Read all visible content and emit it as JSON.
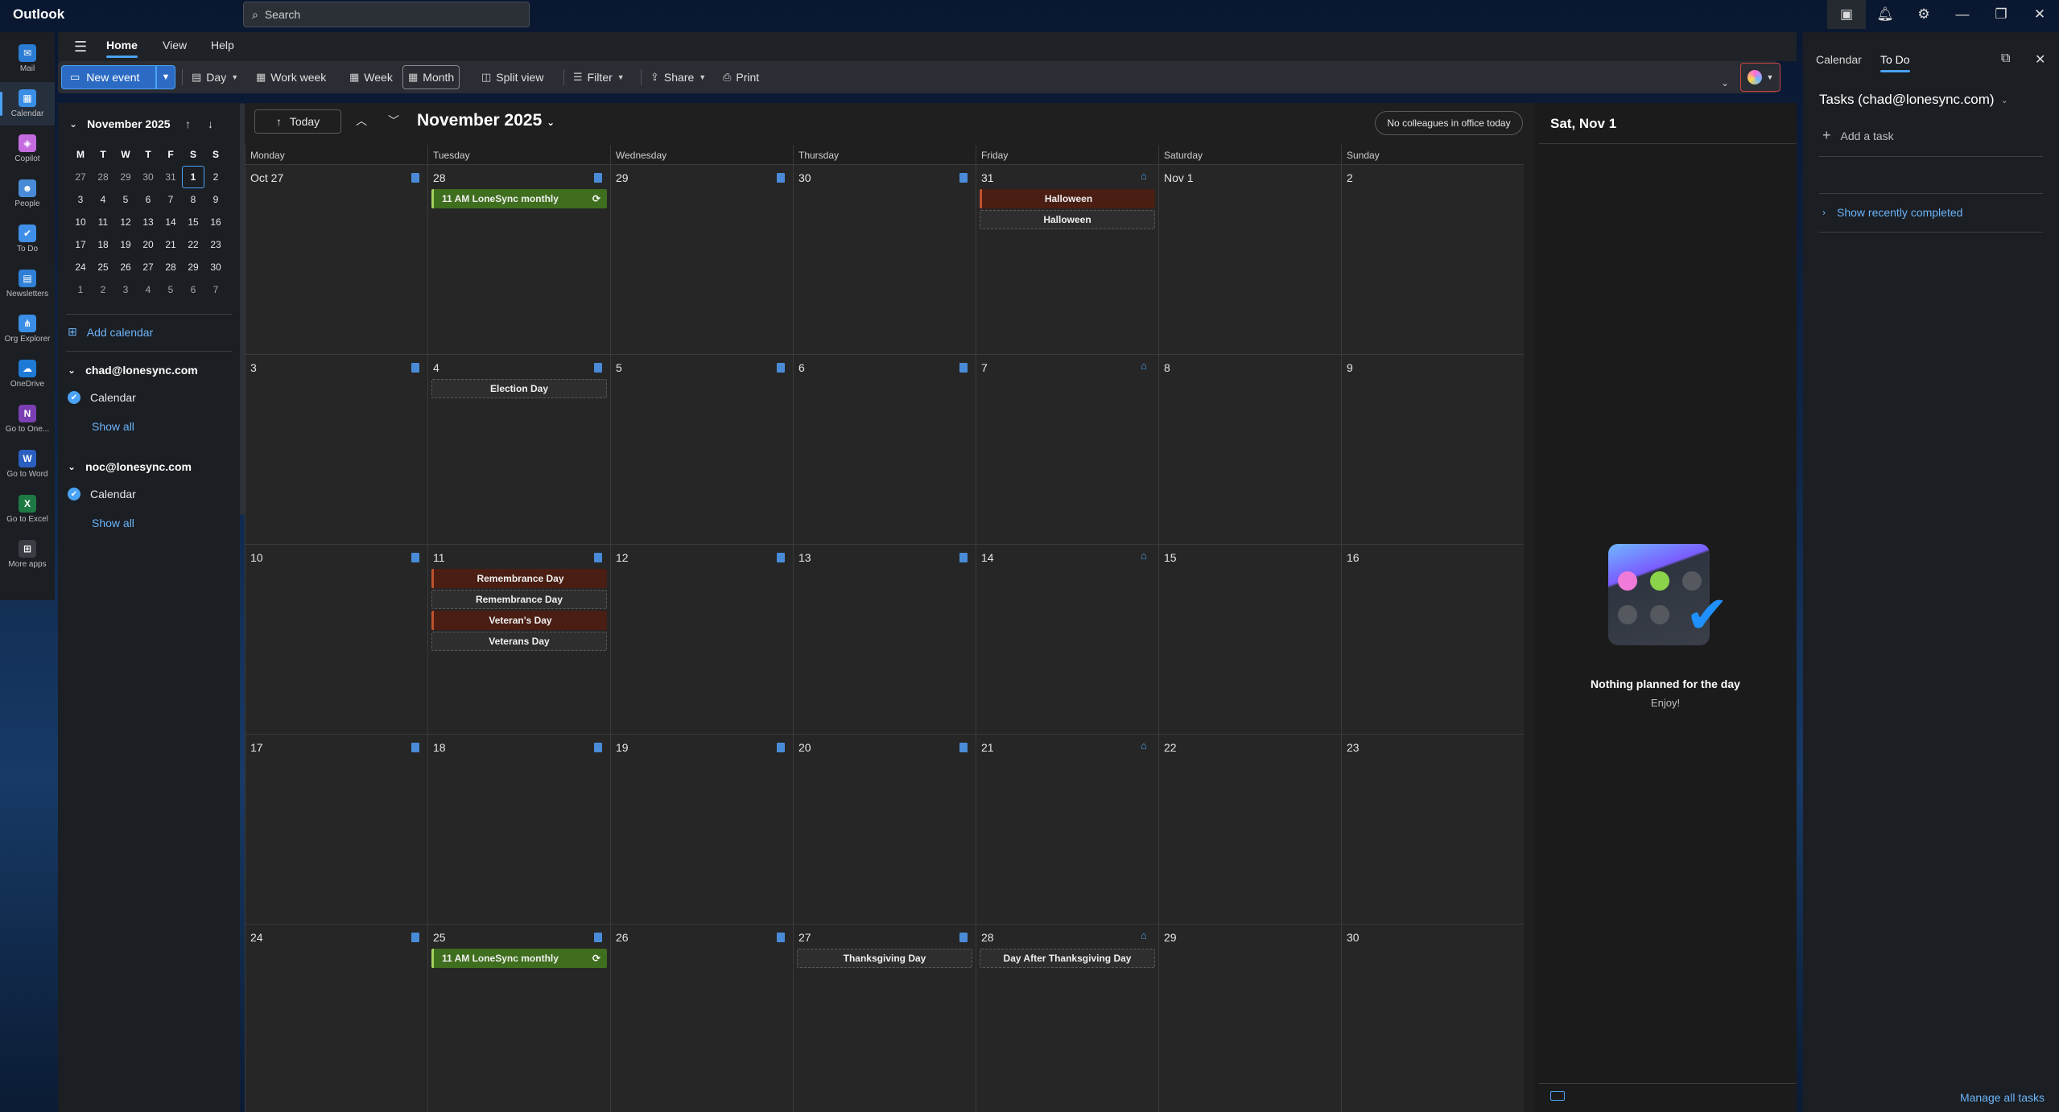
{
  "app": {
    "name": "Outlook"
  },
  "search": {
    "placeholder": "Search"
  },
  "rail": [
    {
      "label": "Mail",
      "color": "#2b7cd3",
      "glyph": "✉"
    },
    {
      "label": "Calendar",
      "color": "#3a8ee6",
      "glyph": "▦",
      "active": true
    },
    {
      "label": "Copilot",
      "color": "#c46be0",
      "glyph": "◈"
    },
    {
      "label": "People",
      "color": "#4a8bd8",
      "glyph": "☻"
    },
    {
      "label": "To Do",
      "color": "#3f8fe8",
      "glyph": "✔"
    },
    {
      "label": "Newsletters",
      "color": "#2f7fd6",
      "glyph": "▤"
    },
    {
      "label": "Org Explorer",
      "color": "#3a8ee6",
      "glyph": "⋔"
    },
    {
      "label": "OneDrive",
      "color": "#1f7ad6",
      "glyph": "☁"
    },
    {
      "label": "Go to One...",
      "color": "#7b3fb3",
      "glyph": "N"
    },
    {
      "label": "Go to Word",
      "color": "#2b5fbf",
      "glyph": "W"
    },
    {
      "label": "Go to Excel",
      "color": "#1e7a45",
      "glyph": "X"
    },
    {
      "label": "More apps",
      "color": "#3a3d44",
      "glyph": "⊞"
    }
  ],
  "ribbon": {
    "tabs": [
      "Home",
      "View",
      "Help"
    ],
    "new_event": "New event",
    "day": "Day",
    "work_week": "Work week",
    "week": "Week",
    "month": "Month",
    "split_view": "Split view",
    "filter": "Filter",
    "share": "Share",
    "print": "Print"
  },
  "mini_calendar": {
    "title": "November 2025",
    "weekday_headers": [
      "M",
      "T",
      "W",
      "T",
      "F",
      "S",
      "S"
    ],
    "weeks": [
      [
        "27",
        "28",
        "29",
        "30",
        "31",
        "1",
        "2"
      ],
      [
        "3",
        "4",
        "5",
        "6",
        "7",
        "8",
        "9"
      ],
      [
        "10",
        "11",
        "12",
        "13",
        "14",
        "15",
        "16"
      ],
      [
        "17",
        "18",
        "19",
        "20",
        "21",
        "22",
        "23"
      ],
      [
        "24",
        "25",
        "26",
        "27",
        "28",
        "29",
        "30"
      ],
      [
        "1",
        "2",
        "3",
        "4",
        "5",
        "6",
        "7"
      ]
    ]
  },
  "left_pane": {
    "add_calendar": "Add calendar",
    "accounts": [
      {
        "email": "chad@lonesync.com",
        "calendar": "Calendar",
        "show_all": "Show all"
      },
      {
        "email": "noc@lonesync.com",
        "calendar": "Calendar",
        "show_all": "Show all"
      }
    ]
  },
  "calendar": {
    "today_label": "Today",
    "title": "November 2025",
    "colleagues": "No colleagues in office today",
    "weekdays": [
      "Monday",
      "Tuesday",
      "Wednesday",
      "Thursday",
      "Friday",
      "Saturday",
      "Sunday"
    ],
    "weeks": [
      [
        {
          "d": "Oct 27",
          "wk": "doc"
        },
        {
          "d": "28",
          "wk": "doc",
          "events": [
            {
              "label": "11 AM LoneSync monthly",
              "type": "green"
            }
          ]
        },
        {
          "d": "29",
          "wk": "doc"
        },
        {
          "d": "30",
          "wk": "doc"
        },
        {
          "d": "31",
          "wk": "home",
          "events": [
            {
              "label": "Halloween",
              "type": "red"
            },
            {
              "label": "Halloween",
              "type": "gray"
            }
          ]
        },
        {
          "d": "Nov 1"
        },
        {
          "d": "2"
        }
      ],
      [
        {
          "d": "3",
          "wk": "doc"
        },
        {
          "d": "4",
          "wk": "doc",
          "events": [
            {
              "label": "Election Day",
              "type": "gray"
            }
          ]
        },
        {
          "d": "5",
          "wk": "doc"
        },
        {
          "d": "6",
          "wk": "doc"
        },
        {
          "d": "7",
          "wk": "home"
        },
        {
          "d": "8"
        },
        {
          "d": "9"
        }
      ],
      [
        {
          "d": "10",
          "wk": "doc"
        },
        {
          "d": "11",
          "wk": "doc",
          "events": [
            {
              "label": "Remembrance Day",
              "type": "red"
            },
            {
              "label": "Remembrance Day",
              "type": "gray"
            },
            {
              "label": "Veteran's Day",
              "type": "red"
            },
            {
              "label": "Veterans Day",
              "type": "gray"
            }
          ]
        },
        {
          "d": "12",
          "wk": "doc"
        },
        {
          "d": "13",
          "wk": "doc"
        },
        {
          "d": "14",
          "wk": "home"
        },
        {
          "d": "15"
        },
        {
          "d": "16"
        }
      ],
      [
        {
          "d": "17",
          "wk": "doc"
        },
        {
          "d": "18",
          "wk": "doc"
        },
        {
          "d": "19",
          "wk": "doc"
        },
        {
          "d": "20",
          "wk": "doc"
        },
        {
          "d": "21",
          "wk": "home"
        },
        {
          "d": "22"
        },
        {
          "d": "23"
        }
      ],
      [
        {
          "d": "24",
          "wk": "doc"
        },
        {
          "d": "25",
          "wk": "doc",
          "events": [
            {
              "label": "11 AM LoneSync monthly",
              "type": "green"
            }
          ]
        },
        {
          "d": "26",
          "wk": "doc"
        },
        {
          "d": "27",
          "wk": "doc",
          "events": [
            {
              "label": "Thanksgiving Day",
              "type": "gray"
            }
          ]
        },
        {
          "d": "28",
          "wk": "home",
          "events": [
            {
              "label": "Day After Thanksgiving Day",
              "type": "gray"
            }
          ]
        },
        {
          "d": "29"
        },
        {
          "d": "30"
        }
      ]
    ]
  },
  "day_pane": {
    "title": "Sat, Nov 1",
    "empty_title": "Nothing planned for the day",
    "empty_sub": "Enjoy!"
  },
  "todo_pane": {
    "tabs": [
      "Calendar",
      "To Do"
    ],
    "tasks_title": "Tasks (chad@lonesync.com)",
    "add_task": "Add a task",
    "show_recent": "Show recently completed",
    "manage": "Manage all tasks"
  }
}
